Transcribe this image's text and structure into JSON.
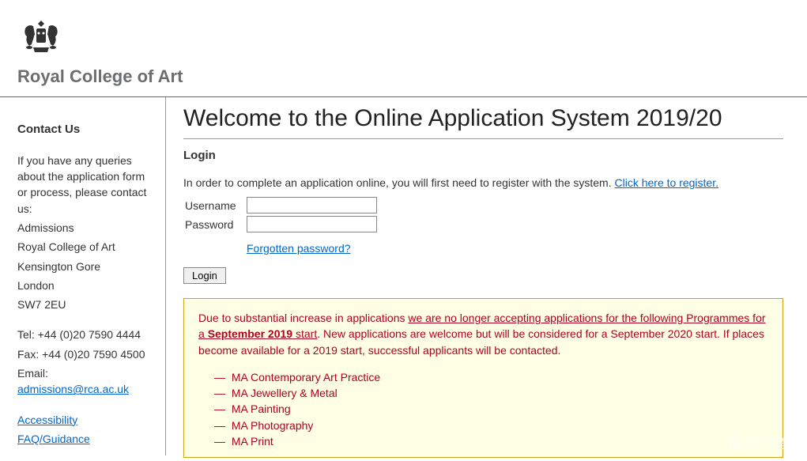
{
  "header": {
    "college_name": "Royal College of Art"
  },
  "sidebar": {
    "heading": "Contact Us",
    "intro": "If you have any queries about the application form or process, please contact us:",
    "org": "Admissions",
    "college": "Royal College of Art",
    "street": "Kensington Gore",
    "city": "London",
    "postcode": "SW7 2EU",
    "tel": "Tel: +44 (0)20 7590 4444",
    "fax": "Fax: +44 (0)20 7590 4500",
    "email_label": "Email: ",
    "email": "admissions@rca.ac.uk",
    "link_accessibility": "Accessibility",
    "link_faq": "FAQ/Guidance"
  },
  "main": {
    "title": "Welcome to the Online Application System 2019/20",
    "login_heading": "Login",
    "intro_text": "In order to complete an application online, you will first need to register with the system. ",
    "register_link": "Click here to register.",
    "username_label": "Username",
    "password_label": "Password",
    "forgotten_link": "Forgotten password?",
    "login_button": "Login"
  },
  "notice": {
    "part1": "Due to substantial increase in applications ",
    "underline_pre": "we are no longer accepting applications for the following Programmes for a ",
    "strong_text": "September 2019",
    "underline_post": " start",
    "part2": ". New applications are welcome but will be considered for a September 2020 start. If places become available for a 2019 start, successful applicants will be contacted.",
    "programmes": [
      "MA Contemporary Art Practice",
      "MA Jewellery & Metal",
      "MA Painting",
      "MA Photography",
      "MA Print"
    ]
  },
  "watermark": "悟空问答"
}
